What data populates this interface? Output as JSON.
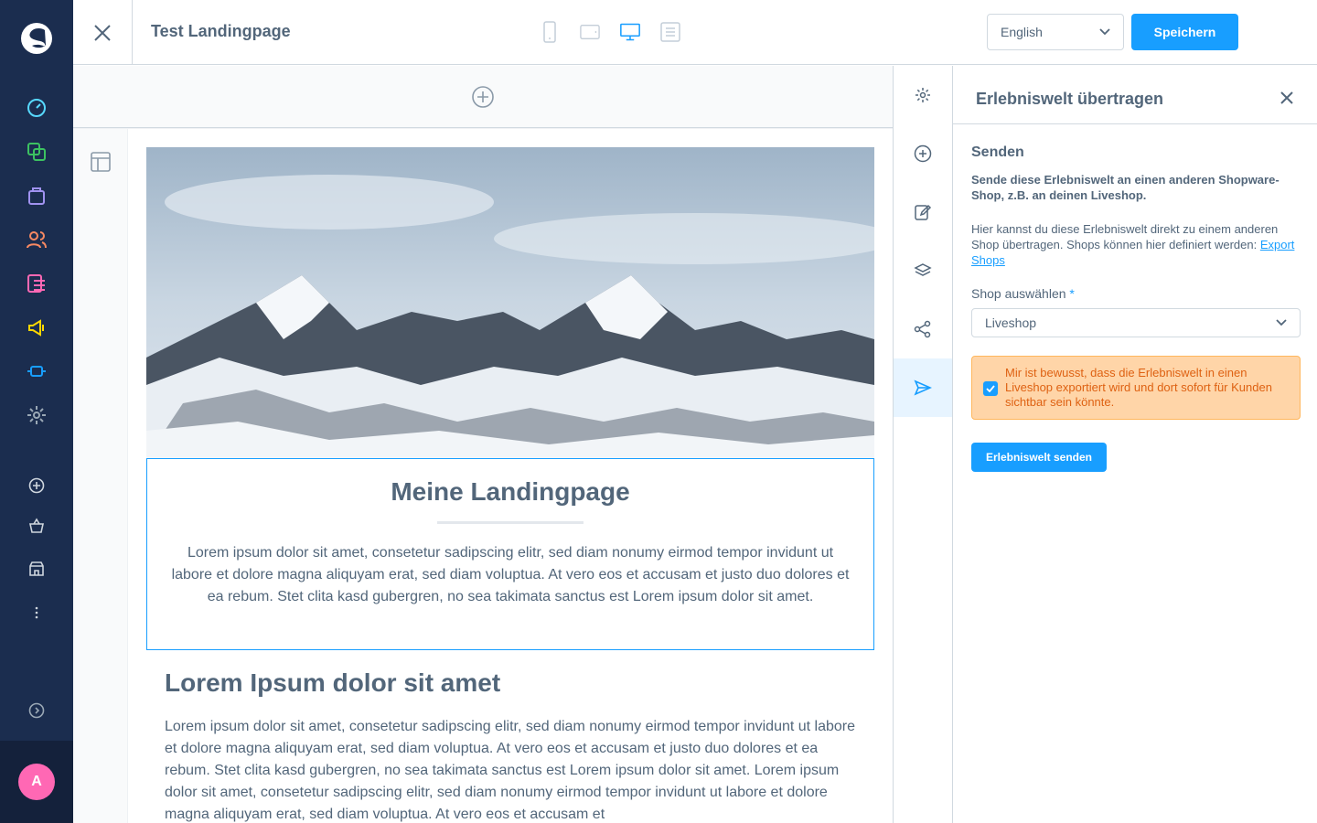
{
  "header": {
    "title": "Test Landingpage",
    "language": "English",
    "save_label": "Speichern"
  },
  "canvas": {
    "hero_heading": "Meine Landingpage",
    "hero_text": "Lorem ipsum dolor sit amet, consetetur sadipscing elitr, sed diam nonumy eirmod tempor invidunt ut labore et dolore magna aliquyam erat, sed diam voluptua. At vero eos et accusam et justo duo dolores et ea rebum. Stet clita kasd gubergren, no sea takimata sanctus est Lorem ipsum dolor sit amet.",
    "section_heading": "Lorem Ipsum dolor sit amet",
    "section_text": "Lorem ipsum dolor sit amet, consetetur sadipscing elitr, sed diam nonumy eirmod tempor invidunt ut labore et dolore magna aliquyam erat, sed diam voluptua. At vero eos et accusam et justo duo dolores et ea rebum. Stet clita kasd gubergren, no sea takimata sanctus est Lorem ipsum dolor sit amet. Lorem ipsum dolor sit amet, consetetur sadipscing elitr, sed diam nonumy eirmod tempor invidunt ut labore et dolore magna aliquyam erat, sed diam voluptua. At vero eos et accusam et"
  },
  "panel": {
    "title": "Erlebniswelt übertragen",
    "section_title": "Senden",
    "description_bold": "Sende diese Erlebniswelt an einen anderen Shopware-Shop, z.B. an deinen Liveshop.",
    "description": "Hier kannst du diese Erlebniswelt direkt zu einem anderen Shop übertragen. Shops können hier definiert werden: ",
    "export_link": "Export Shops",
    "shop_label": "Shop auswählen",
    "shop_required": "*",
    "shop_value": "Liveshop",
    "alert_text": "Mir ist bewusst, dass die Erlebniswelt in einen Liveshop exportiert wird und dort sofort für Kunden sichtbar sein könnte.",
    "alert_checked": true,
    "send_label": "Erlebniswelt senden"
  },
  "user": {
    "initial": "A"
  },
  "colors": {
    "nav_bg": "#1b2d4f",
    "primary": "#189eff",
    "alert_bg": "#ffd5a8",
    "alert_text": "#de6112",
    "avatar": "#ff68b4"
  },
  "nav_icons": [
    "dashboard-icon",
    "catalogue-icon",
    "orders-icon",
    "customers-icon",
    "content-icon",
    "marketing-icon",
    "extensions-icon",
    "settings-icon",
    "add-sales-channel-icon",
    "storefront-basket-icon",
    "shop-icon",
    "more-icon",
    "collapse-icon"
  ],
  "strip_icons": [
    "gear-icon",
    "plus-circle-icon",
    "edit-icon",
    "layers-icon",
    "share-icon",
    "send-icon"
  ]
}
